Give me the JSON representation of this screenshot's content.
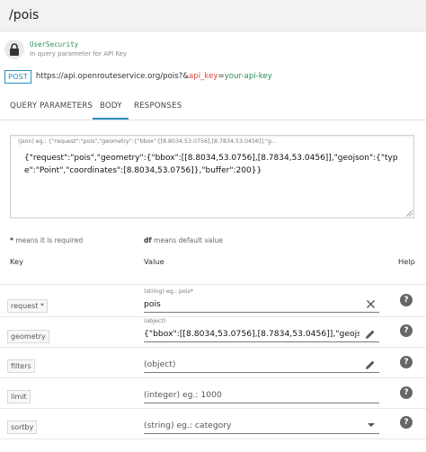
{
  "header": {
    "title": "/pois"
  },
  "security": {
    "name": "UserSecurity",
    "description": "In query parameter for API Key"
  },
  "request_url": {
    "method": "POST",
    "base": "https://api.openrouteservice.org/pois?&",
    "key_name": "api_key",
    "equals": "=",
    "key_value": "your-api-key"
  },
  "tabs": [
    {
      "label": "QUERY PARAMETERS",
      "active": false
    },
    {
      "label": "BODY",
      "active": true
    },
    {
      "label": "RESPONSES",
      "active": false
    }
  ],
  "body": {
    "hint": "(json) eg.: {\"request\":\"pois\",\"geometry\":{\"bbox\":[[8.8034,53.0756],[8.7834,53.0456]],\"g...",
    "value": "{\"request\":\"pois\",\"geometry\":{\"bbox\":[[8.8034,53.0756],[8.7834,53.0456]],\"geojson\":{\"type\":\"Point\",\"coordinates\":[8.8034,53.0756]},\"buffer\":200}}"
  },
  "legend": {
    "required_symbol": "*",
    "required_text": " means it is required",
    "default_symbol": "df",
    "default_text": " means default value"
  },
  "table_headers": {
    "key": "Key",
    "value": "Value",
    "help": "Help"
  },
  "params": [
    {
      "key": "request *",
      "hint": "(string) eg.: pois*",
      "value": "pois",
      "placeholder": "",
      "action_icon": "clear-icon"
    },
    {
      "key": "geometry",
      "hint": "(object)",
      "value": "{\"bbox\":[[8.8034,53.0756],[8.7834,53.0456]],\"geojs...",
      "placeholder": "",
      "action_icon": "edit-icon"
    },
    {
      "key": "filters",
      "hint": "",
      "value": "",
      "placeholder": "(object)",
      "action_icon": "edit-icon"
    },
    {
      "key": "limit",
      "hint": "",
      "value": "",
      "placeholder": "(integer) eg.: 1000",
      "action_icon": ""
    },
    {
      "key": "sortby",
      "hint": "",
      "value": "",
      "placeholder": "(string) eg.: category",
      "action_icon": "dropdown-arrow-icon"
    }
  ],
  "help_symbol": "?",
  "colors": {
    "accent": "#2a8fbd",
    "key_red": "#e0453a",
    "value_green": "#2e8b57"
  }
}
